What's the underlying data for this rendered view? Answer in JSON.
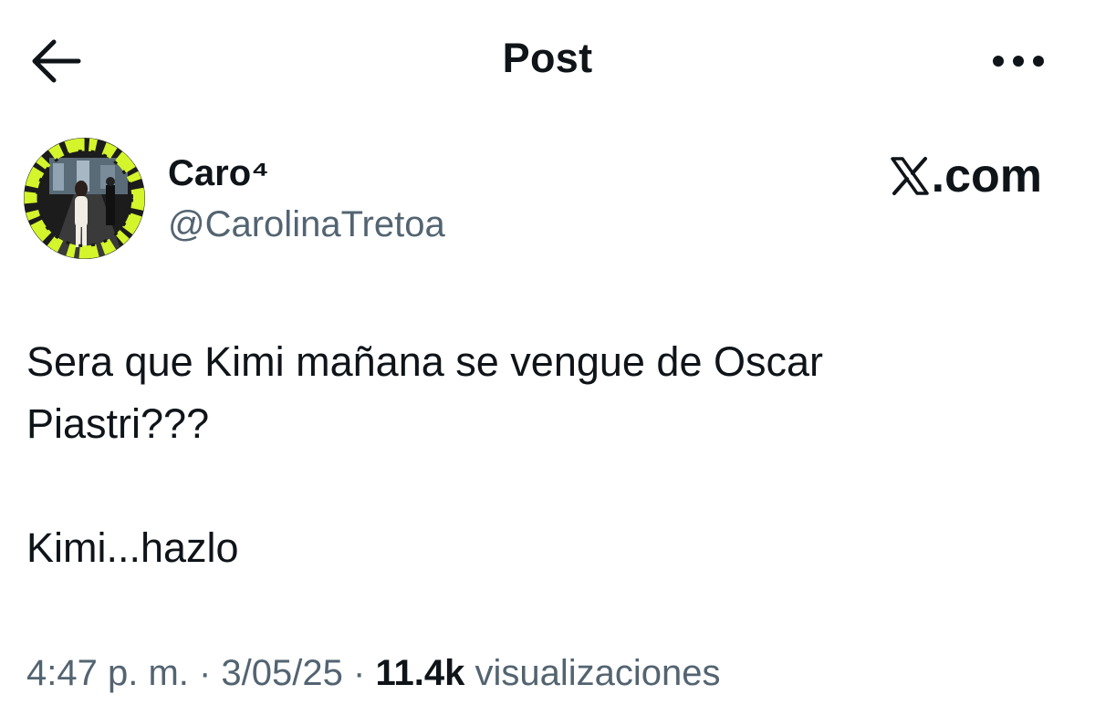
{
  "header": {
    "title": "Post",
    "back_icon": "arrow-left-icon",
    "more_icon": "more-horizontal-icon"
  },
  "author": {
    "display_name": "Caro⁴",
    "handle": "@CarolinaTretoa",
    "avatar_accent": "#d4f52b"
  },
  "source": {
    "label": ".com",
    "icon": "x-logo-icon"
  },
  "tweet": {
    "line1": "Sera que Kimi mañana se vengue de Oscar",
    "line2": "Piastri???",
    "line3": "Kimi...hazlo"
  },
  "meta": {
    "time": "4:47 p. m.",
    "separator1": " · ",
    "date": "3/05/25",
    "separator2": " · ",
    "views_count": "11.4k",
    "views_label": " visualizaciones"
  },
  "colors": {
    "text_primary": "#0f1419",
    "text_secondary": "#536471",
    "background": "#ffffff"
  }
}
